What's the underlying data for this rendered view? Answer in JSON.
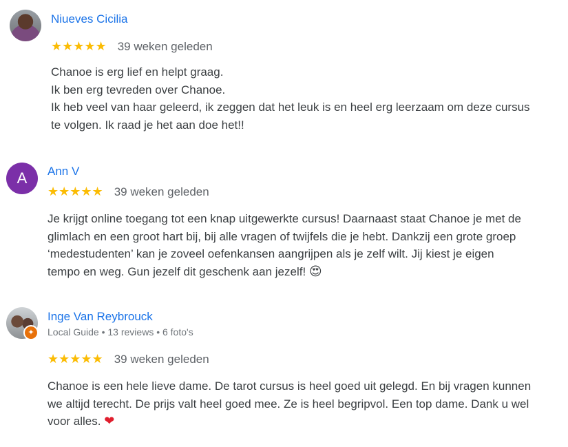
{
  "reviews": [
    {
      "name": "Niueves Cicilia",
      "avatar": {
        "type": "photo"
      },
      "stars": "★★★★★",
      "rating": 5,
      "date": "39 weken geleden",
      "lines": [
        "Chanoe is erg lief en helpt graag.",
        "Ik ben erg tevreden over Chanoe.",
        "Ik heb veel van haar geleerd, ik zeggen dat het leuk is en heel erg leerzaam om deze cursus",
        "te volgen. Ik raad je het aan doe het!!"
      ]
    },
    {
      "name": "Ann V",
      "avatar": {
        "type": "letter",
        "letter": "A",
        "color": "#7b2fa8"
      },
      "stars": "★★★★★",
      "rating": 5,
      "date": "39 weken geleden",
      "lines": [
        "Je krijgt online toegang tot een knap uitgewerkte cursus! Daarnaast staat Chanoe je met de",
        "glimlach en een groot hart bij, bij alle vragen of twijfels die je hebt. Dankzij een grote groep",
        "‘medestudenten’ kan je zoveel oefenkansen aangrijpen als je zelf wilt. Jij kiest je eigen",
        "tempo en weg. Gun jezelf dit geschenk aan jezelf!"
      ],
      "emoji": "😍"
    },
    {
      "name": "Inge Van Reybrouck",
      "avatar": {
        "type": "photo",
        "badge": "local-guide"
      },
      "meta": "Local Guide • 13 reviews • 6 foto's",
      "stars": "★★★★★",
      "rating": 5,
      "date": "39 weken geleden",
      "lines": [
        "Chanoe is een hele lieve dame. De tarot cursus is heel goed uit gelegd. En bij vragen kunnen",
        "we altijd terecht. De prijs valt heel goed mee. Ze is heel begripvol. Een top dame. Dank u wel",
        "voor alles."
      ],
      "emoji": "❤"
    }
  ],
  "colors": {
    "name": "#1a73e8",
    "star": "#fbbc04",
    "text": "#3c4043",
    "meta": "#70757a"
  }
}
